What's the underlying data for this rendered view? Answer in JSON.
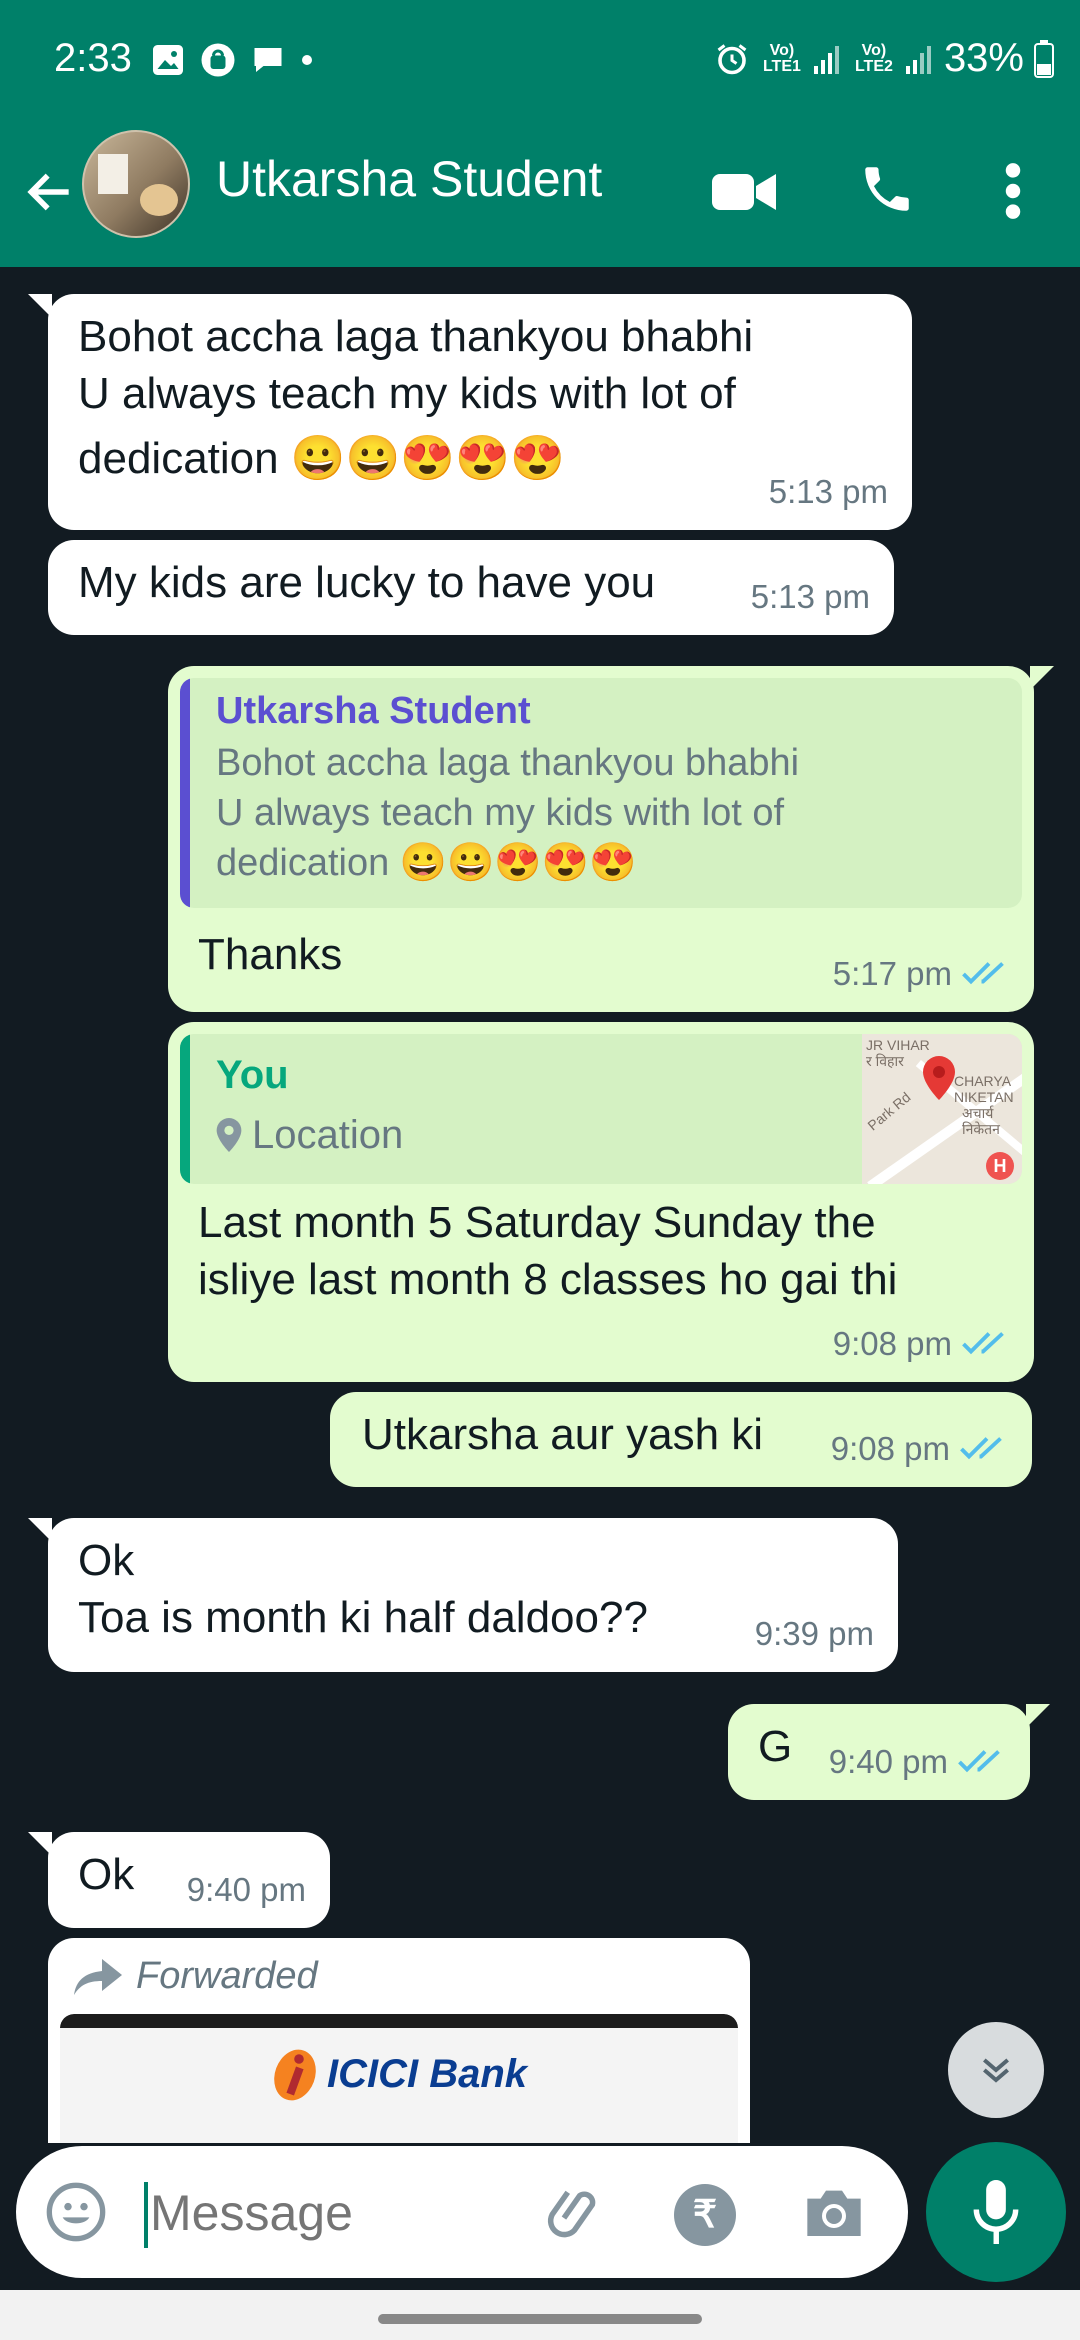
{
  "status_bar": {
    "time": "2:33",
    "network1": "Vo) LTE1",
    "network2": "Vo) LTE2",
    "battery": "33%"
  },
  "header": {
    "contact_name": "Utkarsha Student"
  },
  "messages": [
    {
      "line1": "Bohot accha laga thankyou  bhabhi",
      "line2": "U always teach my kids with lot of",
      "line3": "dedication 😀😀😍😍😍",
      "time": "5:13 pm"
    },
    {
      "text": "My kids are lucky to have you",
      "time": "5:13 pm"
    },
    {
      "quote_author": "Utkarsha Student",
      "quote_line1": "Bohot accha laga thankyou  bhabhi",
      "quote_line2": "U always teach my kids with lot of",
      "quote_line3": "dedication 😀😀😍😍😍",
      "text": "Thanks",
      "time": "5:17 pm"
    },
    {
      "quote_author": "You",
      "quote_label": "Location",
      "map_texts": [
        "JR VIHAR",
        "र विहार",
        "CHARYA",
        "NIKETAN",
        "अचार्य",
        "निकेतन",
        "Park Rd"
      ],
      "line1": "Last month 5 Saturday Sunday  the",
      "line2": "isliye last month 8 classes ho gai thi",
      "time": "9:08 pm"
    },
    {
      "text": "Utkarsha aur yash ki",
      "time": "9:08 pm"
    },
    {
      "line1": "Ok",
      "line2": "Toa is month ki half daldoo??",
      "time": "9:39 pm"
    },
    {
      "text": "G",
      "time": "9:40 pm"
    },
    {
      "text": "Ok",
      "time": "9:40 pm"
    },
    {
      "forwarded_label": "Forwarded",
      "bank_name": "ICICI Bank"
    }
  ],
  "input": {
    "placeholder": "Message"
  },
  "colors": {
    "header_bg": "#008069",
    "incoming_bg": "#ffffff",
    "outgoing_bg": "#e3fccf",
    "tick_blue": "#53bdeb",
    "quote_author_purple": "#5b4fd1",
    "quote_author_green": "#06a77d",
    "chat_bg": "#121b22"
  },
  "icons": [
    "gallery-icon",
    "bag-icon",
    "chat-icon",
    "alarm-icon",
    "signal-icon",
    "battery-icon",
    "back-arrow-icon",
    "video-call-icon",
    "voice-call-icon",
    "more-options-icon",
    "double-tick-icon",
    "location-pin-icon",
    "forward-arrow-icon",
    "scroll-down-icon",
    "emoji-icon",
    "attach-icon",
    "rupee-icon",
    "camera-icon",
    "mic-icon"
  ]
}
